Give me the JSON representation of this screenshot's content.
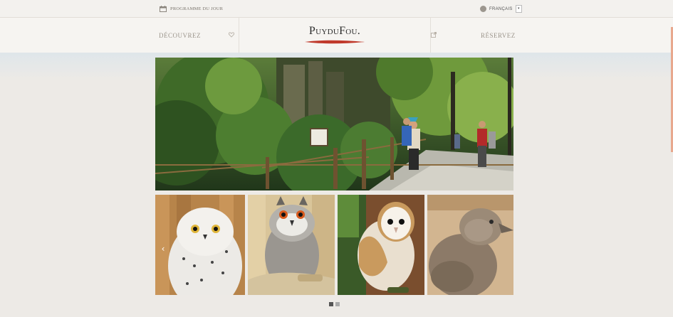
{
  "topbar": {
    "programme_label": "Programme du jour",
    "language_label": "Français",
    "language_dropdown_glyph": "▾"
  },
  "nav": {
    "discover_label": "Découvrez",
    "book_label": "Réservez",
    "logo_text": "PuyduFou."
  },
  "gallery": {
    "prev_arrow": "‹",
    "slides_count": 2,
    "active_slide": 1
  },
  "colors": {
    "accent": "#c0392b",
    "dot_active": "#555555",
    "dot_inactive": "#aaaaaa"
  },
  "icons": {
    "programme": "calendar-icon",
    "language": "globe-icon",
    "discover": "heart-icon",
    "book": "external-link-icon"
  }
}
